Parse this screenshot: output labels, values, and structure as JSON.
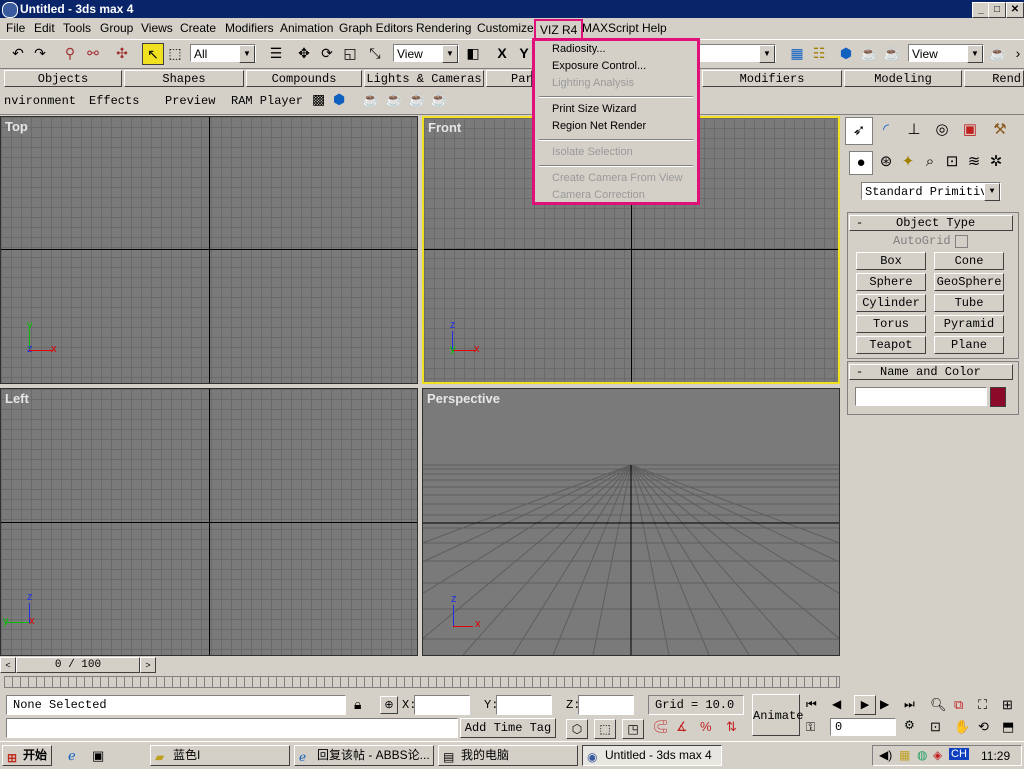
{
  "window": {
    "title": "Untitled - 3ds max 4",
    "min": "_",
    "max": "□",
    "close": "✕"
  },
  "menubar": {
    "items": [
      {
        "label": "File"
      },
      {
        "label": "Edit"
      },
      {
        "label": "Tools"
      },
      {
        "label": "Group"
      },
      {
        "label": "Views"
      },
      {
        "label": "Create"
      },
      {
        "label": "Modifiers"
      },
      {
        "label": "Animation"
      },
      {
        "label": "Graph Editors"
      },
      {
        "label": "Rendering"
      },
      {
        "label": "Customize"
      },
      {
        "label": "VIZ R4"
      },
      {
        "label": "MAXScript"
      },
      {
        "label": "Help"
      }
    ]
  },
  "toolbar": {
    "selection_filter": "All",
    "ref_coord": "View",
    "ref_coord2": "View",
    "axis_x": "X",
    "axis_y": "Y"
  },
  "tabs": {
    "row1": [
      "Objects",
      "Shapes",
      "Compounds",
      "Lights & Cameras",
      "Par",
      "Modifiers",
      "Modeling",
      "Rend"
    ],
    "row2": [
      "nvironment",
      "Effects",
      "Preview",
      "RAM Player"
    ]
  },
  "viewports": {
    "top": "Top",
    "front": "Front",
    "left": "Left",
    "perspective": "Perspective"
  },
  "dropdown": {
    "items": [
      {
        "label": "Radiosity...",
        "enabled": true
      },
      {
        "label": "Exposure Control...",
        "enabled": true
      },
      {
        "label": "Lighting Analysis",
        "enabled": false
      },
      {
        "label": "Print Size Wizard",
        "enabled": true
      },
      {
        "label": "Region Net Render",
        "enabled": true
      },
      {
        "label": "Isolate Selection",
        "enabled": false
      },
      {
        "label": "Create Camera From View",
        "enabled": false
      },
      {
        "label": "Camera Correction",
        "enabled": false
      }
    ]
  },
  "command_panel": {
    "category": "Standard Primitiv",
    "object_type_title": "Object Type",
    "autogrid": "AutoGrid",
    "buttons": [
      "Box",
      "Cone",
      "Sphere",
      "GeoSphere",
      "Cylinder",
      "Tube",
      "Torus",
      "Pyramid",
      "Teapot",
      "Plane"
    ],
    "name_color_title": "Name and Color",
    "object_color": "#8b0a2a"
  },
  "timeline": {
    "frame": "0 / 100"
  },
  "status": {
    "selection": "None Selected",
    "x_label": "X:",
    "y_label": "Y:",
    "z_label": "Z:",
    "grid": "Grid = 10.0",
    "add_time_tag": "Add Time Tag",
    "animate": "Animate",
    "frame_value": "0"
  },
  "taskbar": {
    "start": "开始",
    "tasks": [
      "蓝色I",
      "回复该帖 - ABBS论...",
      "我的电脑",
      "Untitled - 3ds max 4"
    ],
    "tray_lang": "CH",
    "clock": "11:29"
  },
  "colors": {
    "highlight": "#e0107b",
    "active_viewport": "#f0e020",
    "axis_x": "#e00000",
    "axis_y": "#00c000",
    "axis_z": "#2030e0"
  }
}
